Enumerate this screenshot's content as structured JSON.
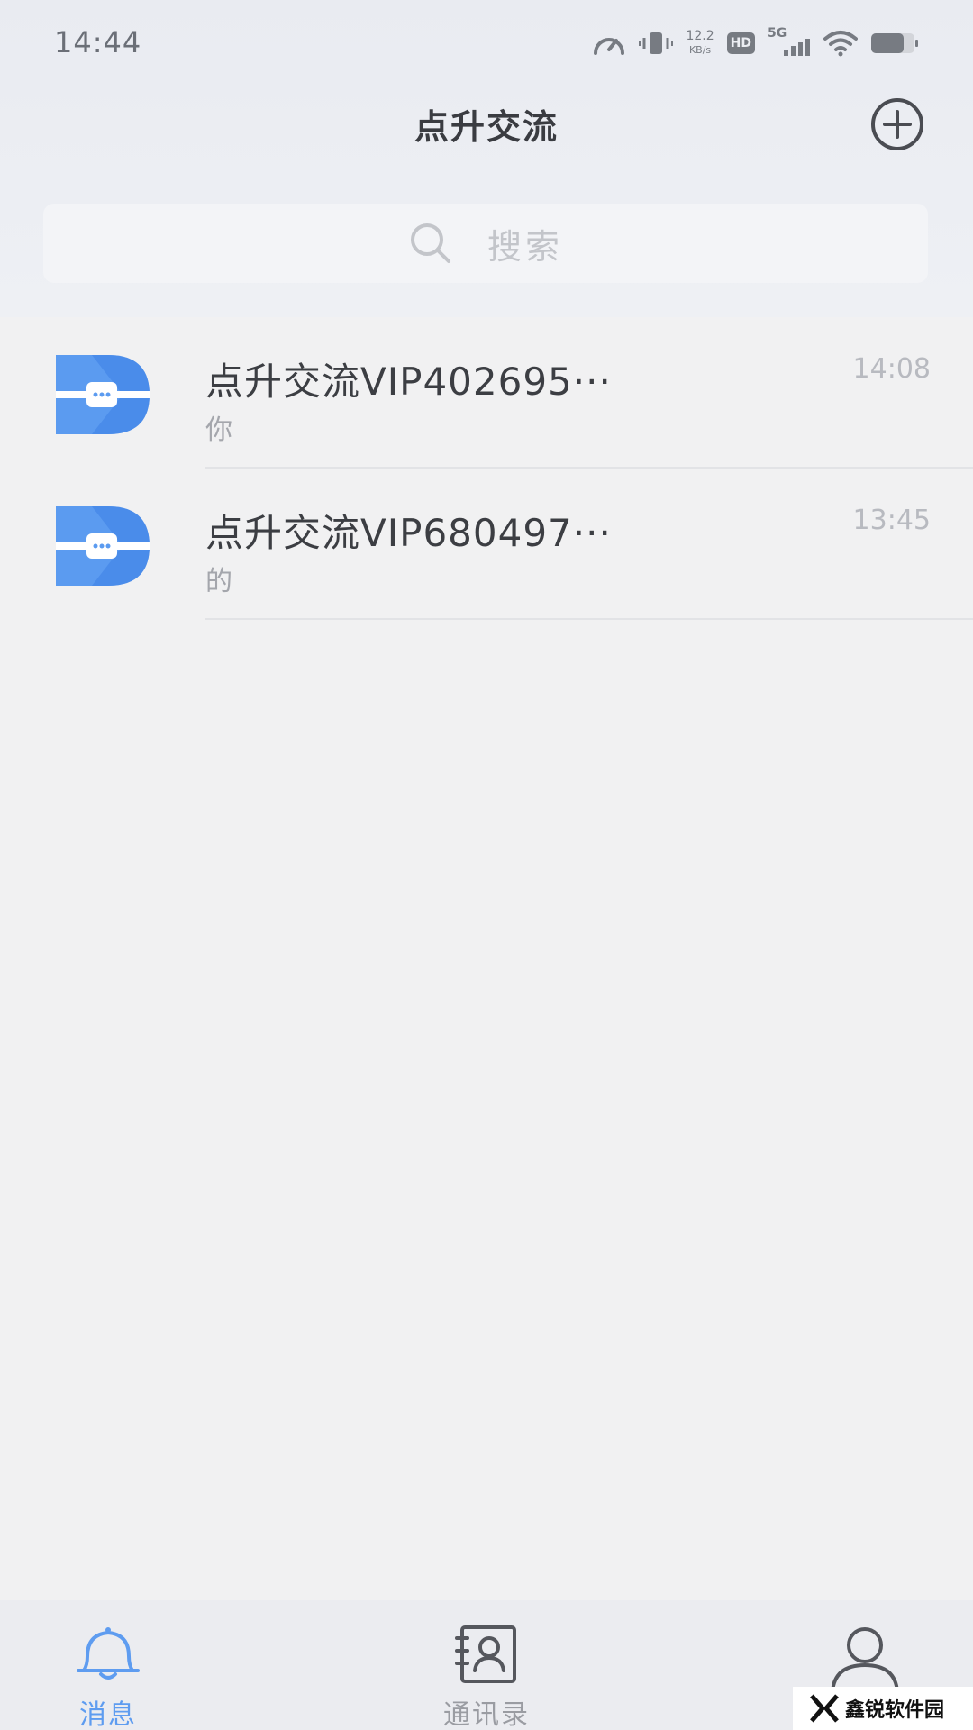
{
  "status_bar": {
    "time": "14:44",
    "net_speed_value": "12.2",
    "net_speed_unit": "KB/s",
    "hd_label": "HD",
    "network_label": "5G"
  },
  "header": {
    "title": "点升交流",
    "add_icon": "plus-circle-icon"
  },
  "search": {
    "placeholder": "搜索",
    "icon": "search-icon"
  },
  "conversations": [
    {
      "name": "点升交流VIP402695···",
      "time": "14:08",
      "preview": "你"
    },
    {
      "name": "点升交流VIP680497···",
      "time": "13:45",
      "preview": "的"
    }
  ],
  "tab_bar": {
    "tabs": [
      {
        "label": "消息",
        "icon": "bell-icon",
        "active": true
      },
      {
        "label": "通讯录",
        "icon": "contacts-icon",
        "active": false
      },
      {
        "label": "",
        "icon": "profile-icon",
        "active": false
      }
    ]
  },
  "colors": {
    "accent": "#5e9cf0",
    "avatar_blue": "#5b9bf0"
  },
  "watermark": {
    "text": "鑫锐软件园"
  }
}
